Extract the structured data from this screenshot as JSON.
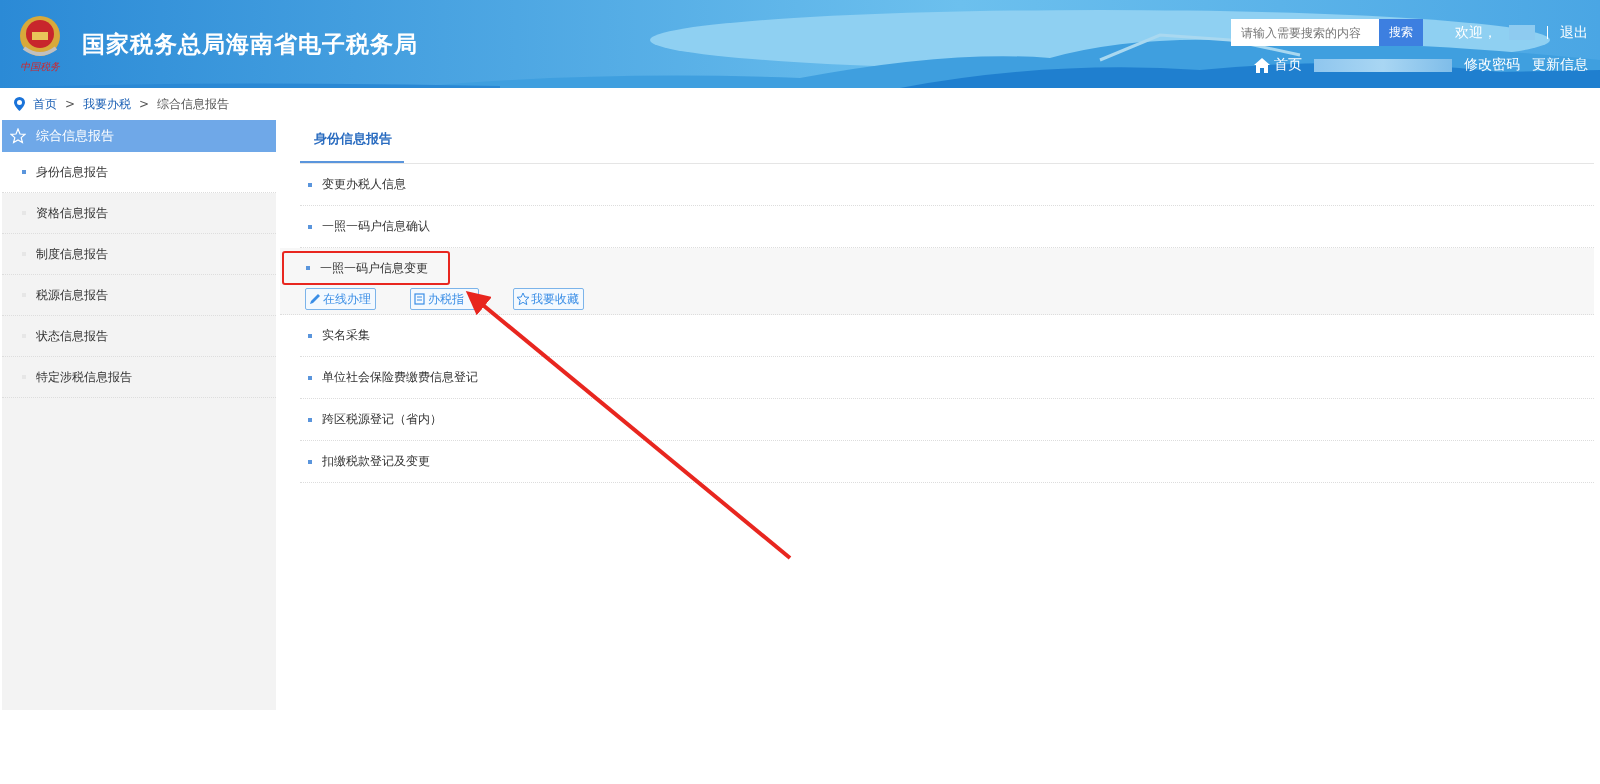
{
  "header": {
    "title": "国家税务总局海南省电子税务局",
    "logo_caption": "中国税务",
    "search": {
      "placeholder": "请输入需要搜索的内容",
      "button": "搜索"
    },
    "welcome": "欢迎，",
    "logout": "退出",
    "home": "首页",
    "links": [
      "修改密码",
      "更新信息"
    ]
  },
  "breadcrumb": [
    {
      "label": "首页",
      "link": true
    },
    {
      "label": "我要办税",
      "link": true
    },
    {
      "label": "综合信息报告",
      "link": false
    }
  ],
  "breadcrumb_separator": ">",
  "sidebar": {
    "title": "综合信息报告",
    "items": [
      {
        "label": "身份信息报告",
        "selected": true
      },
      {
        "label": "资格信息报告",
        "selected": false
      },
      {
        "label": "制度信息报告",
        "selected": false
      },
      {
        "label": "税源信息报告",
        "selected": false
      },
      {
        "label": "状态信息报告",
        "selected": false
      },
      {
        "label": "特定涉税信息报告",
        "selected": false
      }
    ]
  },
  "tabs": [
    {
      "label": "身份信息报告",
      "selected": true
    }
  ],
  "items": [
    {
      "label": "变更办税人信息",
      "expanded": false
    },
    {
      "label": "一照一码户信息确认",
      "expanded": false
    },
    {
      "label": "一照一码户信息变更",
      "expanded": true,
      "highlighted": true,
      "actions": [
        {
          "kind": "edit",
          "label": "在线办理"
        },
        {
          "kind": "guide",
          "label": "办税指"
        },
        {
          "kind": "star",
          "label": "我要收藏"
        }
      ]
    },
    {
      "label": "实名采集",
      "expanded": false
    },
    {
      "label": "单位社会保险费缴费信息登记",
      "expanded": false
    },
    {
      "label": "跨区税源登记（省内）",
      "expanded": false
    },
    {
      "label": "扣缴税款登记及变更",
      "expanded": false
    }
  ]
}
